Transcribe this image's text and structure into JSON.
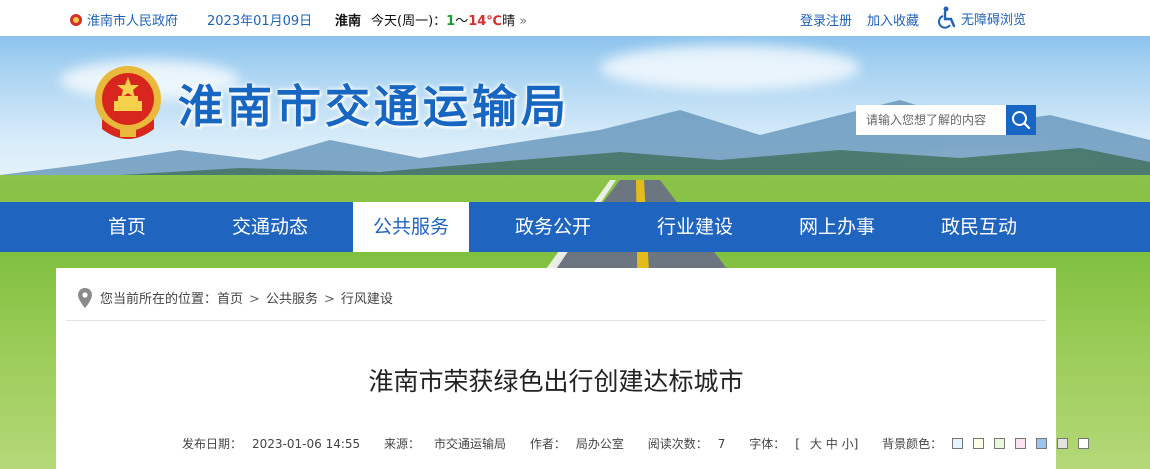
{
  "topbar": {
    "gov_link": "淮南市人民政府",
    "date": "2023年01月09日",
    "city": "淮南",
    "weather_prefix": "今天(周一)：",
    "temp_low": "1",
    "temp_sep": "～",
    "temp_high": "14℃",
    "weather": "晴",
    "more_glyph": "»",
    "login": "登录注册",
    "favorite": "加入收藏",
    "accessibility": "无障碍浏览"
  },
  "header": {
    "site_title": "淮南市交通运输局",
    "emblem_icon": "national-emblem-icon",
    "search_placeholder": "请输入您想了解的内容",
    "search_icon": "search-icon"
  },
  "nav": {
    "items": [
      {
        "label": "首页",
        "active": false
      },
      {
        "label": "交通动态",
        "active": false
      },
      {
        "label": "公共服务",
        "active": true
      },
      {
        "label": "政务公开",
        "active": false
      },
      {
        "label": "行业建设",
        "active": false
      },
      {
        "label": "网上办事",
        "active": false
      },
      {
        "label": "政民互动",
        "active": false
      }
    ]
  },
  "breadcrumb": {
    "prefix": "您当前所在的位置：",
    "items": [
      "首页",
      "公共服务",
      "行风建设"
    ],
    "separator": ">"
  },
  "article": {
    "title": "淮南市荣获绿色出行创建达标城市",
    "publish_date_label": "发布日期：",
    "publish_date": "2023-01-06 14:55",
    "source_label": "来源：",
    "source": "市交通运输局",
    "author_label": "作者：",
    "author": "局办公室",
    "views_label": "阅读次数：",
    "views": "7",
    "font_label": "字体：",
    "font_open": "[",
    "font_large": "大",
    "font_medium": "中",
    "font_small": "小",
    "font_close": "]",
    "bg_label": "背景颜色：",
    "bg_colors": [
      "#e6f4ff",
      "#fffde6",
      "#e8f8e1",
      "#fbe3f3",
      "#9dc3ef",
      "#e3e3e3",
      "#ffffff"
    ]
  },
  "colors": {
    "primary_blue": "#1f64bf",
    "title_blue": "#1666c2",
    "link_blue": "#1f62b5"
  }
}
